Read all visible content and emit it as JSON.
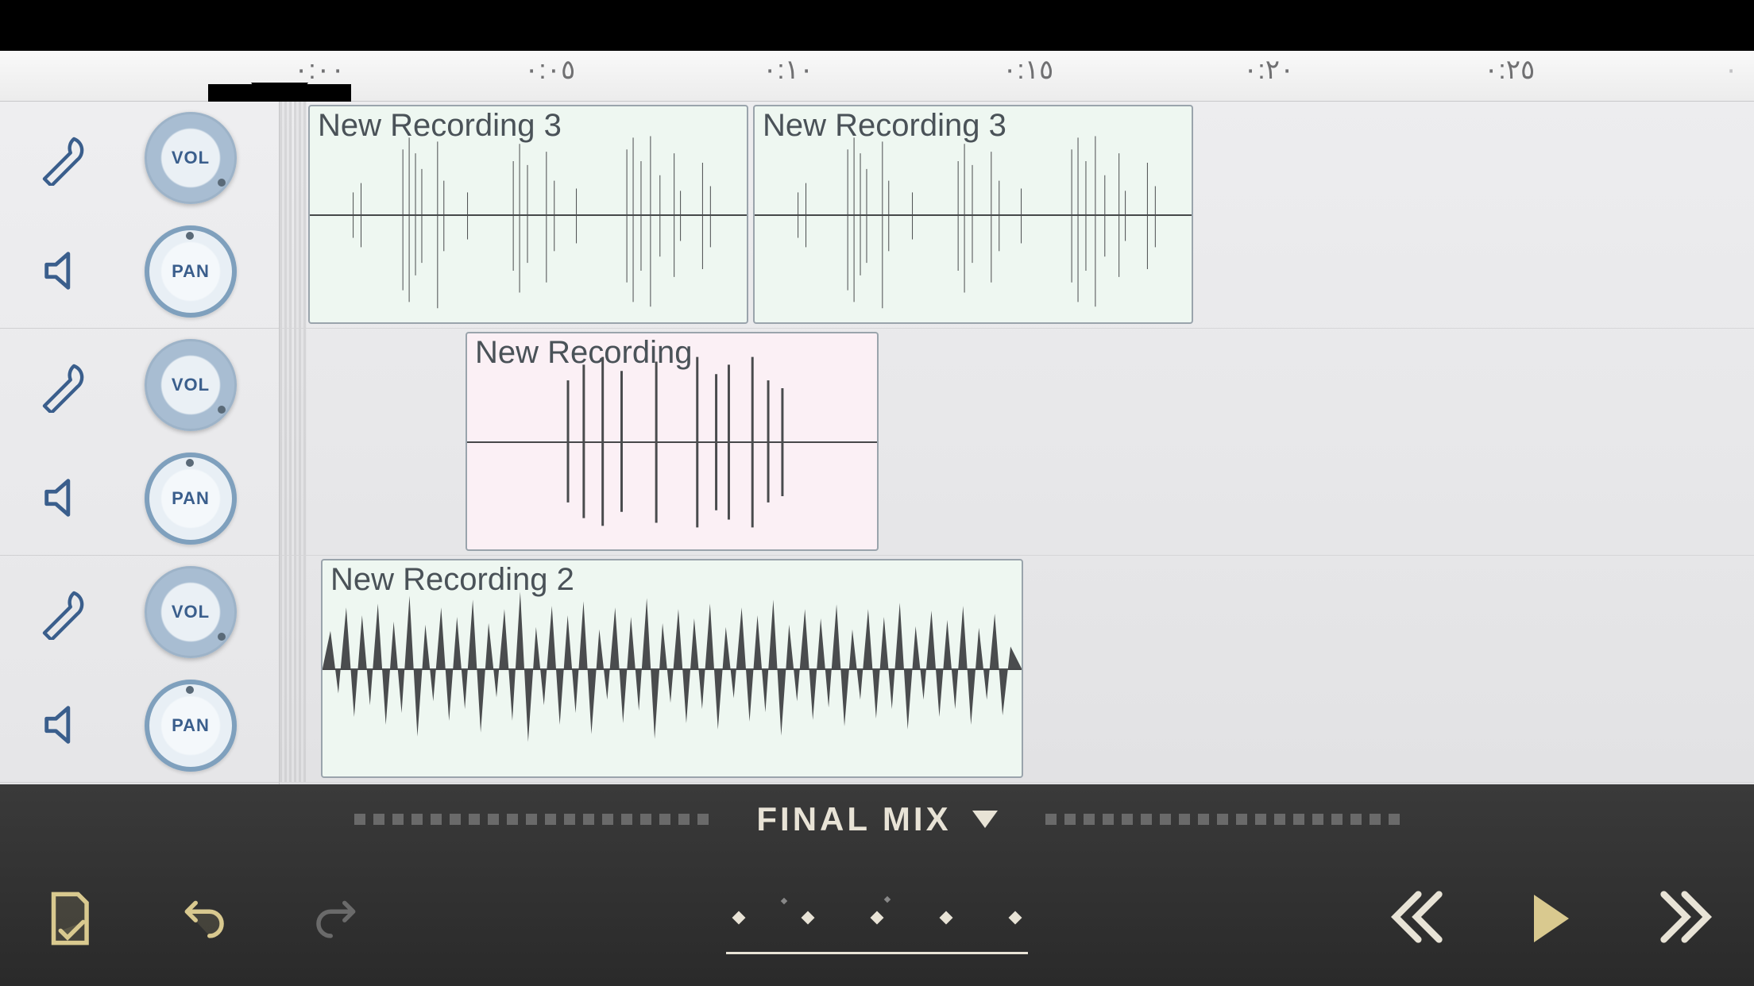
{
  "ruler": {
    "ticks": [
      "٠:٠٠",
      "٠:٠٥",
      "٠:١٠",
      "٠:١٥",
      "٠:٢٠",
      "٠:٢٥"
    ]
  },
  "knob_labels": {
    "vol": "VOL",
    "pan": "PAN"
  },
  "tracks": [
    {
      "clips": [
        {
          "label": "New Recording 3"
        },
        {
          "label": "New Recording 3"
        }
      ]
    },
    {
      "clips": [
        {
          "label": "New Recording"
        }
      ]
    },
    {
      "clips": [
        {
          "label": "New Recording 2"
        }
      ]
    }
  ],
  "bottom": {
    "mix_label": "FINAL MIX"
  }
}
